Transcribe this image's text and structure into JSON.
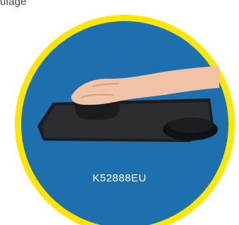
{
  "top_text": "ulage",
  "product": {
    "code": "K52888EU"
  },
  "colors": {
    "ring": "#ffe600",
    "circle": "#1e6fae",
    "mousepad": "#2b2d30",
    "mouse": "#1b1c1f",
    "hand": "#f1c2a6"
  },
  "icons": {
    "product_image": "mouse-pad-with-wrist-rest-photo"
  }
}
